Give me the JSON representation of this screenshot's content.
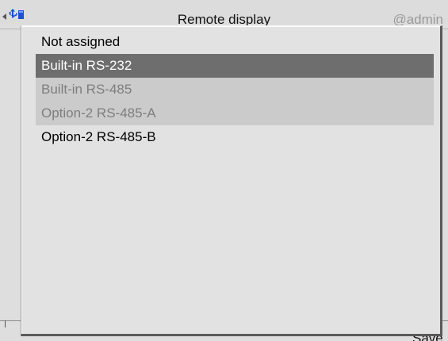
{
  "header": {
    "title": "Remote display",
    "user": "@admin",
    "back_icon": "back-arrow-icon",
    "status_icon": "network-usb-icon"
  },
  "footer": {
    "save_label": "Save"
  },
  "popup": {
    "items": [
      {
        "label": "Not assigned",
        "state": "normal"
      },
      {
        "label": "Built-in RS-232",
        "state": "selected"
      },
      {
        "label": "Built-in RS-485",
        "state": "disabled"
      },
      {
        "label": "Option-2 RS-485-A",
        "state": "disabled"
      },
      {
        "label": "Option-2 RS-485-B",
        "state": "normal"
      }
    ]
  },
  "colors": {
    "background": "#dedede",
    "selected_bg": "#6e6e6e",
    "selected_text": "#ffffff",
    "disabled_bg": "#cbcbcb",
    "disabled_text": "#7e7e7e",
    "icon_blue": "#1c50d8"
  }
}
